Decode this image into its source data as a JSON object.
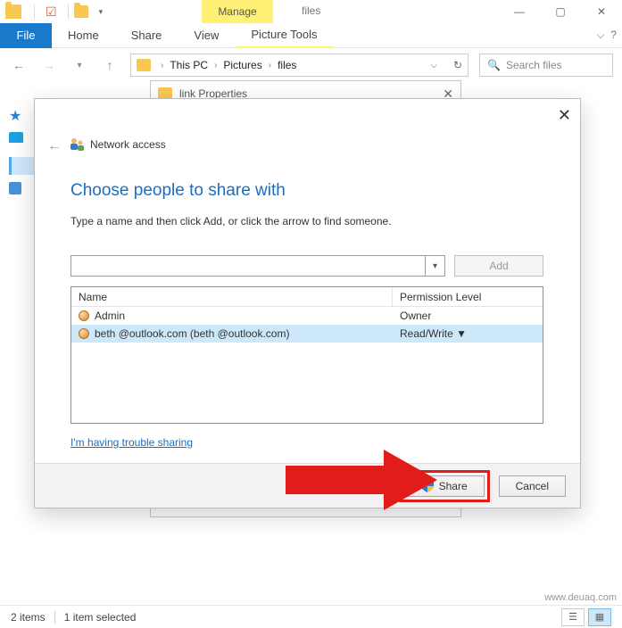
{
  "ribbon": {
    "manage": "Manage",
    "file": "File",
    "home": "Home",
    "share": "Share",
    "view": "View",
    "picture_tools": "Picture Tools"
  },
  "window": {
    "title": "files"
  },
  "address": {
    "root": "This PC",
    "seg1": "Pictures",
    "seg2": "files"
  },
  "search": {
    "placeholder": "Search files"
  },
  "propwin": {
    "title": "link Properties"
  },
  "dlg": {
    "title": "Network access",
    "heading": "Choose people to share with",
    "sub": "Type a name and then click Add, or click the arrow to find someone.",
    "add": "Add",
    "col_name": "Name",
    "col_perm": "Permission Level",
    "rows": [
      {
        "name": "Admin",
        "perm": "Owner"
      },
      {
        "name": "beth        @outlook.com (beth        @outlook.com)",
        "perm": "Read/Write ▼"
      }
    ],
    "trouble": "I'm having trouble sharing",
    "share": "Share",
    "cancel": "Cancel"
  },
  "status": {
    "items": "2 items",
    "selected": "1 item selected"
  },
  "watermark": "www.deuaq.com"
}
